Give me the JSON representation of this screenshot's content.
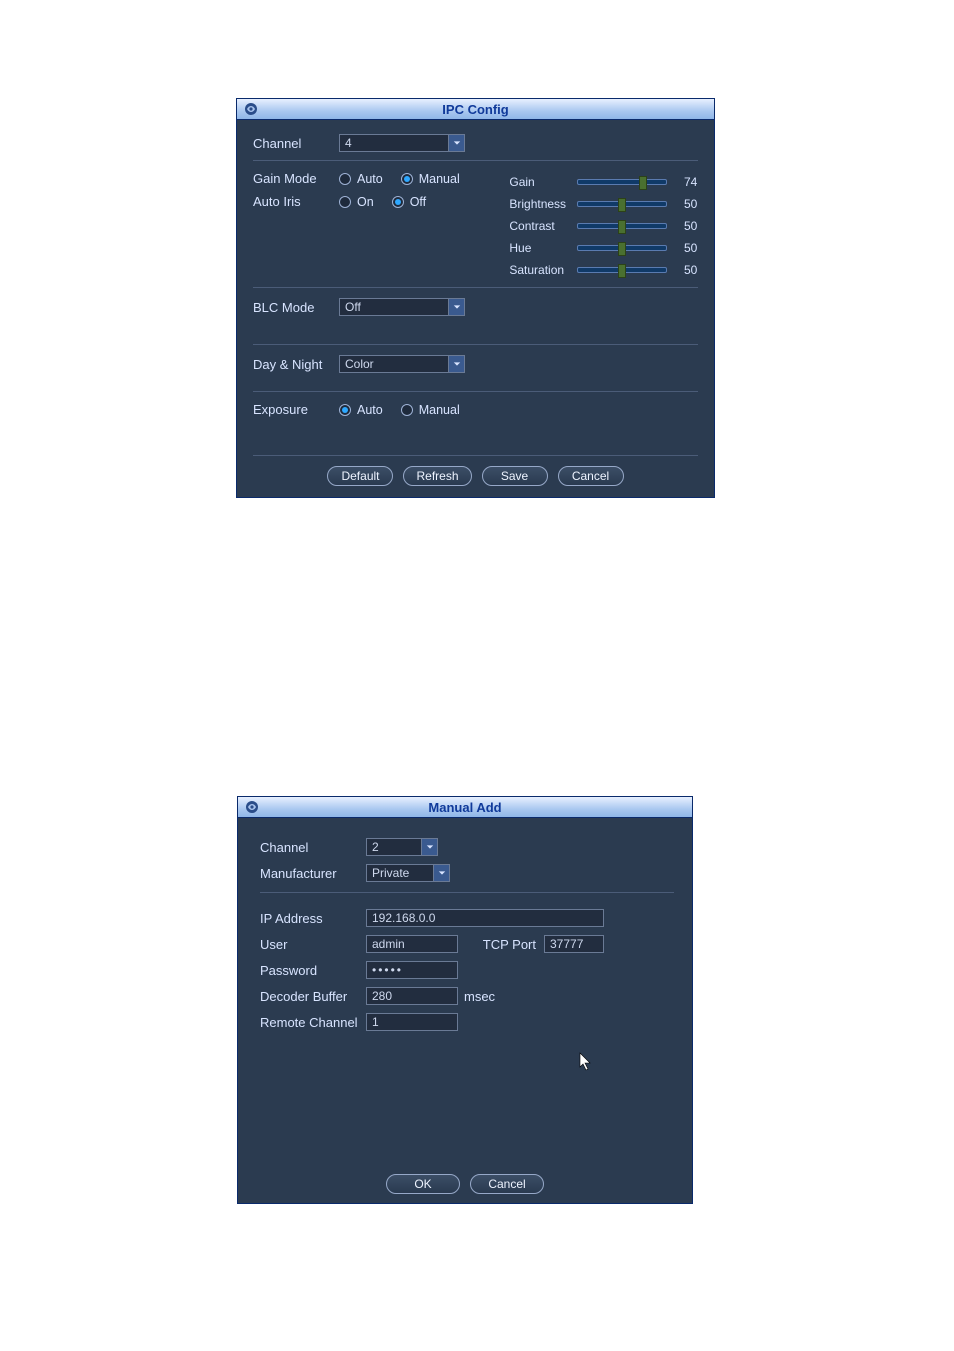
{
  "ipc": {
    "title": "IPC Config",
    "channel_label": "Channel",
    "channel_value": "4",
    "gain_mode": {
      "label": "Gain Mode",
      "opt_auto": "Auto",
      "opt_manual": "Manual",
      "selected": "Manual"
    },
    "auto_iris": {
      "label": "Auto Iris",
      "opt_on": "On",
      "opt_off": "Off",
      "selected": "Off"
    },
    "sliders": {
      "gain": {
        "label": "Gain",
        "value": 74
      },
      "brightness": {
        "label": "Brightness",
        "value": 50
      },
      "contrast": {
        "label": "Contrast",
        "value": 50
      },
      "hue": {
        "label": "Hue",
        "value": 50
      },
      "saturation": {
        "label": "Saturation",
        "value": 50
      }
    },
    "blc_mode": {
      "label": "BLC Mode",
      "value": "Off"
    },
    "day_night": {
      "label": "Day & Night",
      "value": "Color"
    },
    "exposure": {
      "label": "Exposure",
      "opt_auto": "Auto",
      "opt_manual": "Manual",
      "selected": "Auto"
    },
    "buttons": {
      "default": "Default",
      "refresh": "Refresh",
      "save": "Save",
      "cancel": "Cancel"
    }
  },
  "manual_add": {
    "title": "Manual Add",
    "channel": {
      "label": "Channel",
      "value": "2"
    },
    "manufacturer": {
      "label": "Manufacturer",
      "value": "Private"
    },
    "ip_address": {
      "label": "IP Address",
      "value": "192.168.0.0"
    },
    "user": {
      "label": "User",
      "value": "admin"
    },
    "tcp_port": {
      "label": "TCP Port",
      "value": "37777"
    },
    "password": {
      "label": "Password",
      "value": "•••••"
    },
    "decoder_buffer": {
      "label": "Decoder Buffer",
      "value": "280",
      "unit": "msec"
    },
    "remote_channel": {
      "label": "Remote Channel",
      "value": "1"
    },
    "buttons": {
      "ok": "OK",
      "cancel": "Cancel"
    }
  }
}
